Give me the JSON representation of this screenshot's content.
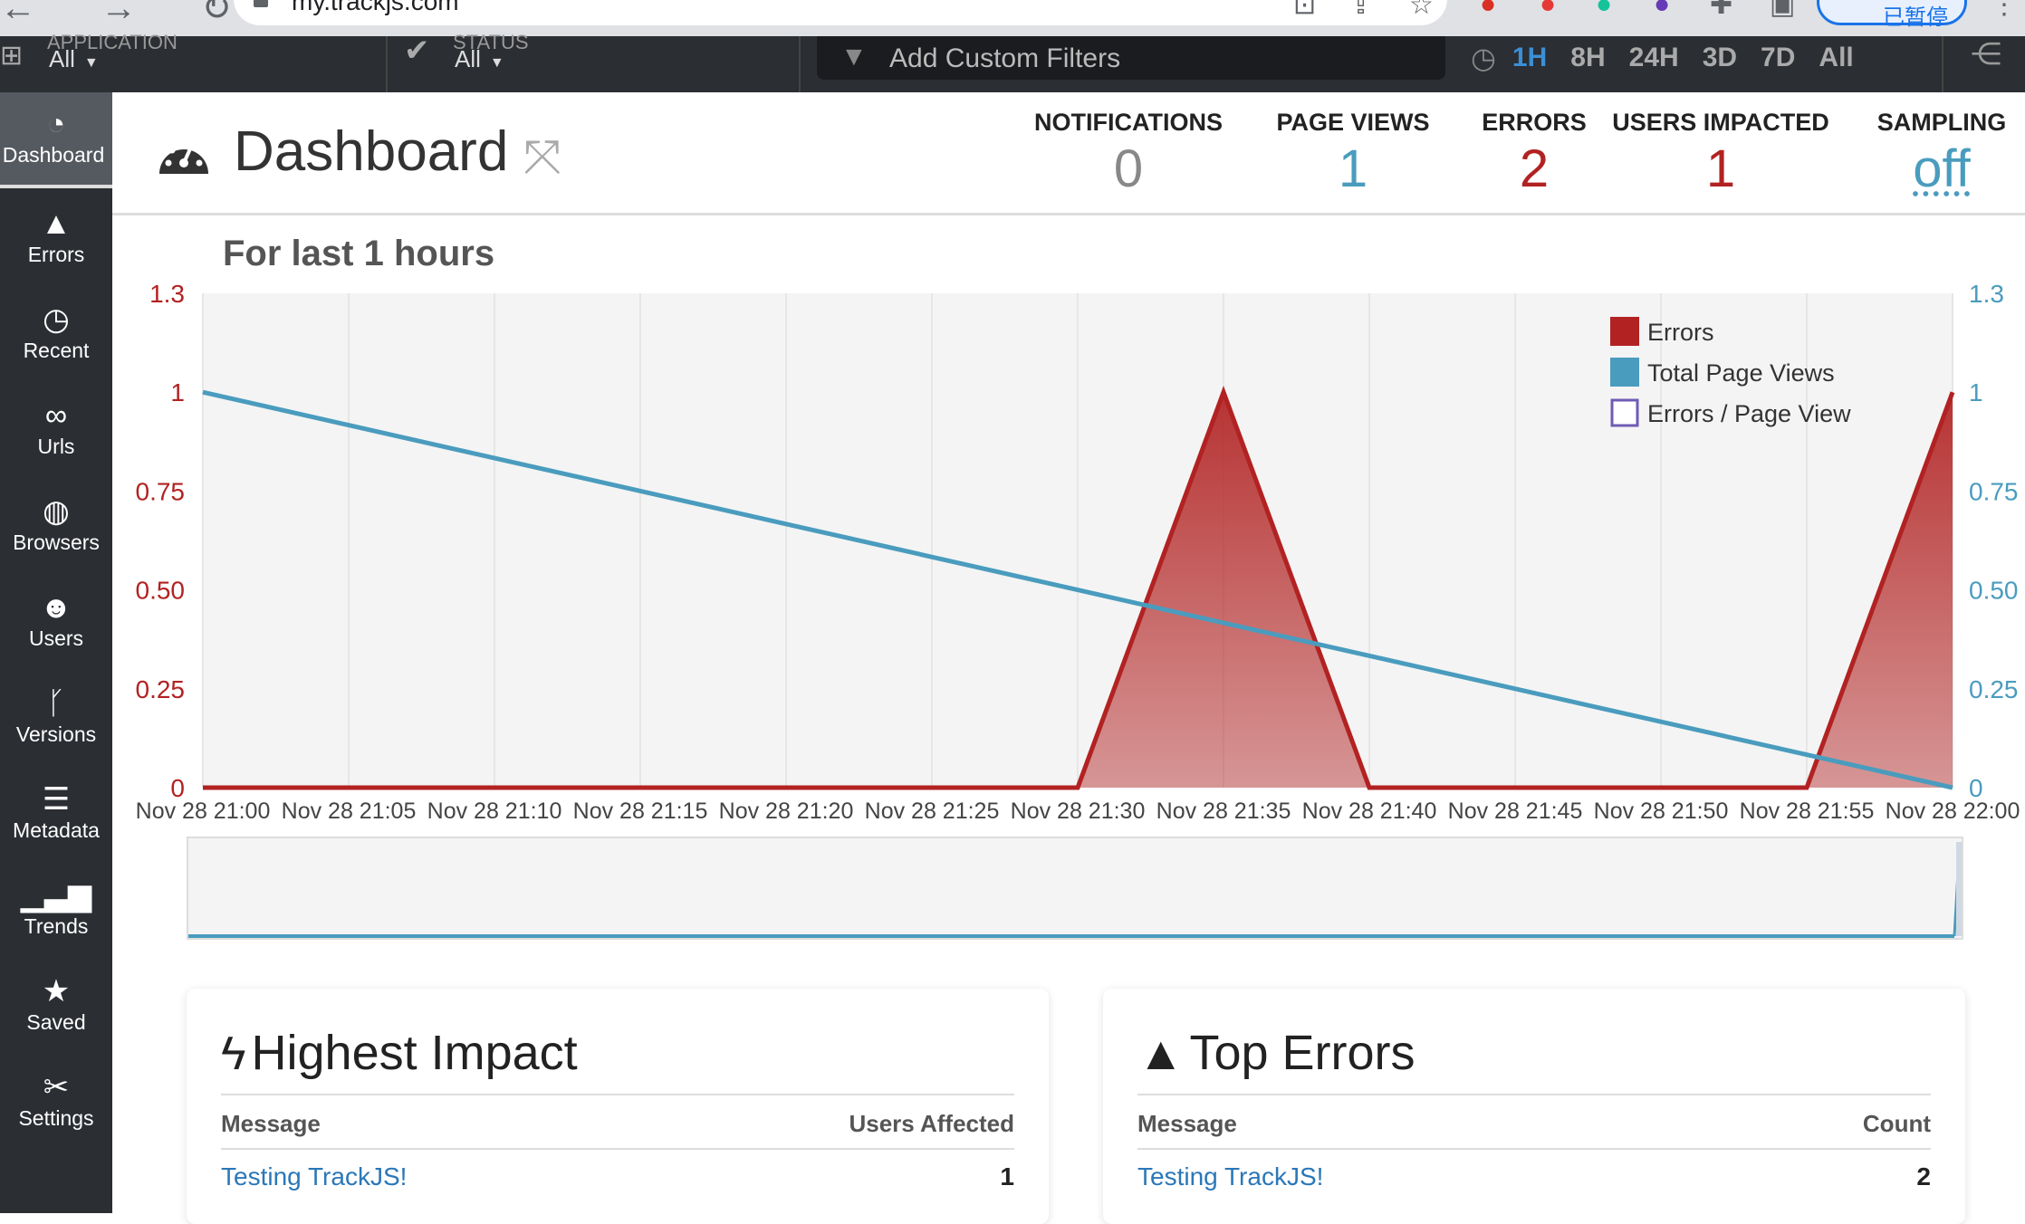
{
  "browser": {
    "url": "my.trackjs.com",
    "profile_label": "已暂停"
  },
  "topnav": {
    "filters": [
      {
        "label": "APPLICATION",
        "value": "All"
      },
      {
        "label": "STATUS",
        "value": "All"
      }
    ],
    "custom_filter_placeholder": "Add Custom Filters",
    "time_ranges": [
      "1H",
      "8H",
      "24H",
      "3D",
      "7D",
      "All"
    ],
    "active_time_range": "1H"
  },
  "sidebar": {
    "items": [
      {
        "label": "Dashboard",
        "icon": "gauge-icon",
        "active": true
      },
      {
        "label": "Errors",
        "icon": "warning-icon"
      },
      {
        "label": "Recent",
        "icon": "clock-icon"
      },
      {
        "label": "Urls",
        "icon": "link-icon"
      },
      {
        "label": "Browsers",
        "icon": "globe-icon"
      },
      {
        "label": "Users",
        "icon": "users-icon"
      },
      {
        "label": "Versions",
        "icon": "branch-icon"
      },
      {
        "label": "Metadata",
        "icon": "database-icon"
      },
      {
        "label": "Trends",
        "icon": "bars-icon"
      },
      {
        "label": "Saved",
        "icon": "star-icon"
      },
      {
        "label": "Settings",
        "icon": "tools-icon"
      }
    ]
  },
  "header": {
    "title": "Dashboard",
    "stats": [
      {
        "label": "NOTIFICATIONS",
        "value": "0",
        "color": "#888888"
      },
      {
        "label": "PAGE VIEWS",
        "value": "1",
        "color": "#4a9cbe"
      },
      {
        "label": "ERRORS",
        "value": "2",
        "color": "#b22222"
      },
      {
        "label": "USERS IMPACTED",
        "value": "1",
        "color": "#b22222"
      },
      {
        "label": "SAMPLING",
        "value": "off",
        "color": "#4a9cbe"
      }
    ]
  },
  "chart_title": "For last 1 hours",
  "chart_data": {
    "type": "area",
    "x": [
      "Nov 28 21:00",
      "Nov 28 21:05",
      "Nov 28 21:10",
      "Nov 28 21:15",
      "Nov 28 21:20",
      "Nov 28 21:25",
      "Nov 28 21:30",
      "Nov 28 21:35",
      "Nov 28 21:40",
      "Nov 28 21:45",
      "Nov 28 21:50",
      "Nov 28 21:55",
      "Nov 28 22:00"
    ],
    "series": [
      {
        "name": "Errors",
        "color": "#b22222",
        "points": [
          [
            0,
            0
          ],
          [
            30,
            0
          ],
          [
            35,
            1
          ],
          [
            40,
            0
          ],
          [
            55,
            0
          ],
          [
            60,
            1
          ]
        ]
      },
      {
        "name": "Total Page Views",
        "color": "#4a9cbe",
        "points": [
          [
            0,
            1
          ],
          [
            60,
            0
          ]
        ]
      },
      {
        "name": "Errors / Page View",
        "color": "#6f5bb5",
        "points": []
      }
    ],
    "y_left_ticks": [
      "0",
      "0.25",
      "0.50",
      "0.75",
      "1",
      "1.3"
    ],
    "y_right_ticks": [
      "0",
      "0.25",
      "0.50",
      "0.75",
      "1",
      "1.3"
    ],
    "ylim": [
      0,
      1.25
    ],
    "legend_position": "top-right",
    "grid": true
  },
  "panels": {
    "highest_impact": {
      "title": "Highest Impact",
      "col_message": "Message",
      "col_value": "Users Affected",
      "rows": [
        {
          "message": "Testing TrackJS!",
          "value": "1"
        }
      ]
    },
    "top_errors": {
      "title": "Top Errors",
      "col_message": "Message",
      "col_value": "Count",
      "rows": [
        {
          "message": "Testing TrackJS!",
          "value": "2"
        }
      ]
    }
  }
}
